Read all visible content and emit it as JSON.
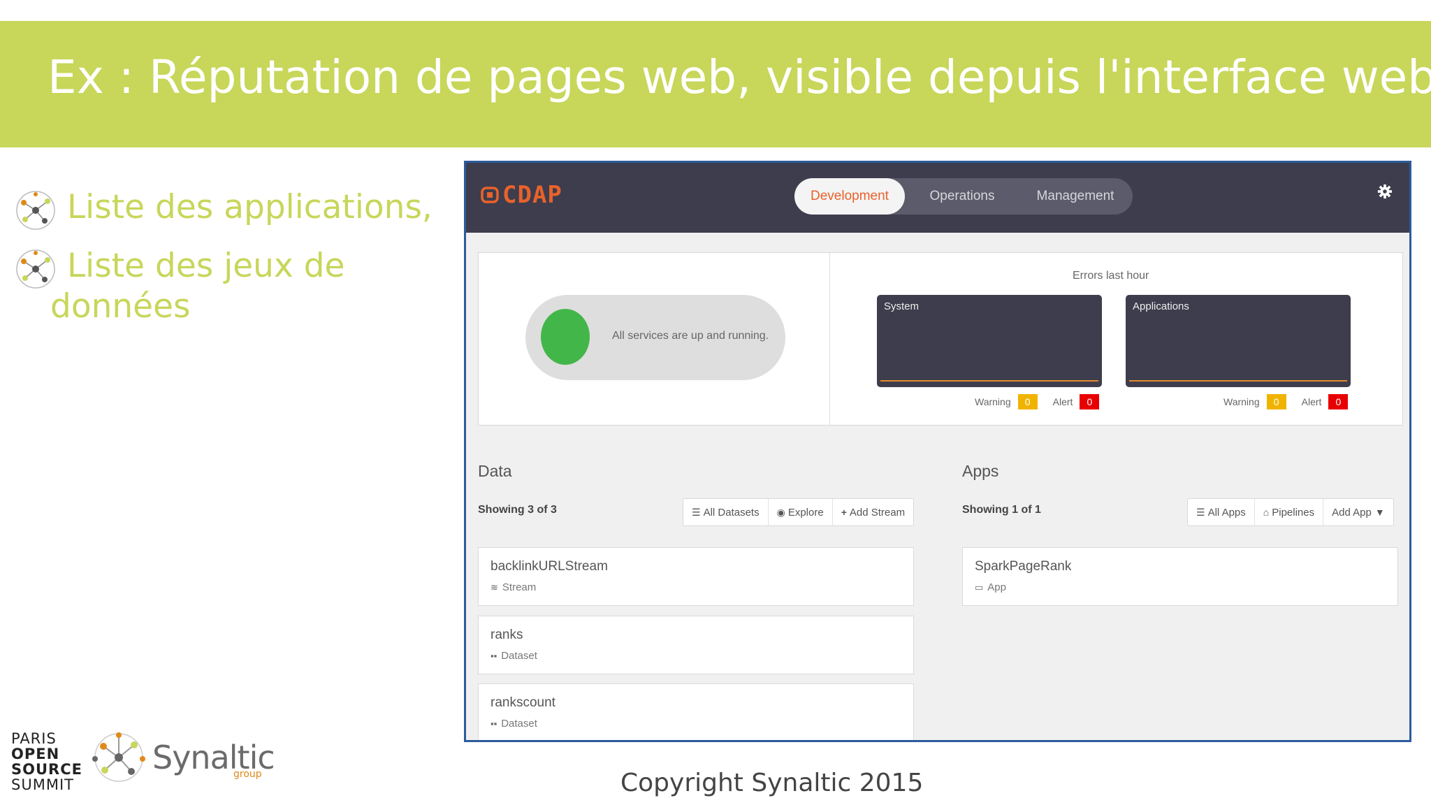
{
  "slide": {
    "title": "Ex : Réputation de pages web, visible depuis l'interface web",
    "bullets": [
      "Liste des applications,",
      "Liste des jeux de",
      "données"
    ],
    "copyright": "Copyright Synaltic 2015",
    "logos": {
      "pos_lines": [
        "PARIS",
        "OPEN",
        "SOURCE",
        "SUMMIT"
      ],
      "synaltic": "Synaltic",
      "synaltic_sub": "group"
    },
    "colors": {
      "banner": "#c8d65a",
      "frame": "#2c5b9e"
    }
  },
  "app": {
    "logo": "CDAP",
    "tabs": [
      "Development",
      "Operations",
      "Management"
    ],
    "active_tab": "Development",
    "status": {
      "message": "All services are up and running."
    },
    "errors": {
      "title": "Errors last hour",
      "system": {
        "label": "System",
        "warning_label": "Warning",
        "warning": "0",
        "alert_label": "Alert",
        "alert": "0"
      },
      "applications": {
        "label": "Applications",
        "warning_label": "Warning",
        "warning": "0",
        "alert_label": "Alert",
        "alert": "0"
      }
    },
    "data": {
      "title": "Data",
      "showing": "Showing 3 of 3",
      "buttons": [
        "All Datasets",
        "Explore",
        "Add Stream"
      ],
      "items": [
        {
          "name": "backlinkURLStream",
          "type": "Stream"
        },
        {
          "name": "ranks",
          "type": "Dataset"
        },
        {
          "name": "rankscount",
          "type": "Dataset"
        }
      ]
    },
    "apps": {
      "title": "Apps",
      "showing": "Showing 1 of 1",
      "buttons": [
        "All Apps",
        "Pipelines",
        "Add App"
      ],
      "items": [
        {
          "name": "SparkPageRank",
          "type": "App"
        }
      ]
    },
    "colors": {
      "navbar": "#3d3d4d",
      "accent": "#e8622b",
      "ok": "#43b649",
      "warning": "#f0b400",
      "alert": "#e80000"
    }
  }
}
